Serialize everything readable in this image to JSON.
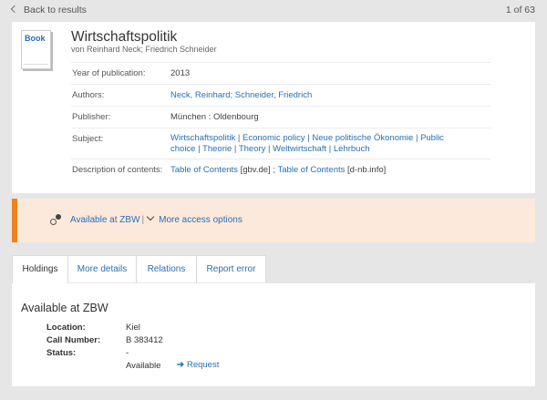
{
  "nav": {
    "back_label": "Back to results",
    "pager": "1 of 63"
  },
  "record": {
    "type_badge": "Book",
    "title": "Wirtschaftspolitik",
    "byline": "von Reinhard Neck; Friedrich Schneider",
    "fields": {
      "year": {
        "label": "Year of publication:",
        "value": "2013"
      },
      "authors": {
        "label": "Authors:",
        "value": "Neck, Reinhard; Schneider, Friedrich"
      },
      "publisher": {
        "label": "Publisher:",
        "value": "München : Oldenbourg"
      },
      "subject": {
        "label": "Subject:",
        "items": [
          "Wirtschaftspolitik",
          "Economic policy",
          "Neue politische Ökonomie",
          "Public choice",
          "Theorie",
          "Theory",
          "Weltwirtschaft",
          "Lehrbuch"
        ],
        "separator": " | "
      },
      "contents": {
        "label": "Description of contents:",
        "link1": "Table of Contents",
        "src1": " [gbv.de]",
        "sep": " ; ",
        "link2": "Table of Contents",
        "src2": " [d-nb.info]"
      }
    }
  },
  "access": {
    "available_label": "Available at ZBW",
    "separator": "|",
    "more_label": "More access options"
  },
  "tabs": [
    {
      "label": "Holdings",
      "active": true
    },
    {
      "label": "More details",
      "active": false
    },
    {
      "label": "Relations",
      "active": false
    },
    {
      "label": "Report error",
      "active": false
    }
  ],
  "holdings": {
    "heading": "Available at ZBW",
    "location": {
      "label": "Location:",
      "value": "Kiel"
    },
    "call_number": {
      "label": "Call Number:",
      "value": "B 383412"
    },
    "status": {
      "label": "Status:",
      "value": "-"
    },
    "availability": "Available",
    "request_label": "Request"
  },
  "colors": {
    "accent": "#f0821e",
    "link": "#2a6fb5",
    "access_bg": "#fce9db",
    "page_bg": "#e6e6e6"
  },
  "icons": [
    "chevron-left-icon",
    "book-icon",
    "access-icon",
    "chevron-down-icon",
    "arrow-right-icon"
  ]
}
